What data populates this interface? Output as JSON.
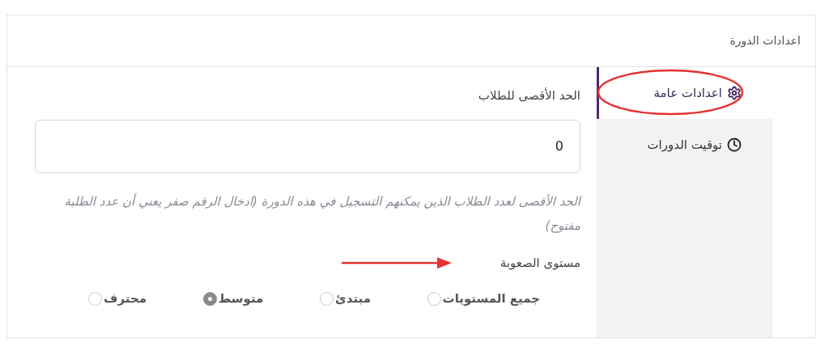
{
  "header": {
    "title": "اعدادات الدورة"
  },
  "sidebar": {
    "items": [
      {
        "label": "اعدادات عامة",
        "selected": true
      },
      {
        "label": "توقيت الدورات",
        "selected": false
      }
    ]
  },
  "max_students": {
    "label": "الحد الأقصى للطلاب",
    "value": "0",
    "help": "الحد الأقصى لعدد الطلاب الذين يمكنهم التسجيل في هذه الدورة (ادخال الرقم صفر يعني أن عدد الطلبة مفتوح)"
  },
  "difficulty": {
    "label": "مستوى الصعوبة",
    "options": [
      {
        "label": "جميع المستويات",
        "selected": false
      },
      {
        "label": "مبتدئ",
        "selected": false
      },
      {
        "label": "متوسط",
        "selected": true
      },
      {
        "label": "محترف",
        "selected": false
      }
    ]
  }
}
